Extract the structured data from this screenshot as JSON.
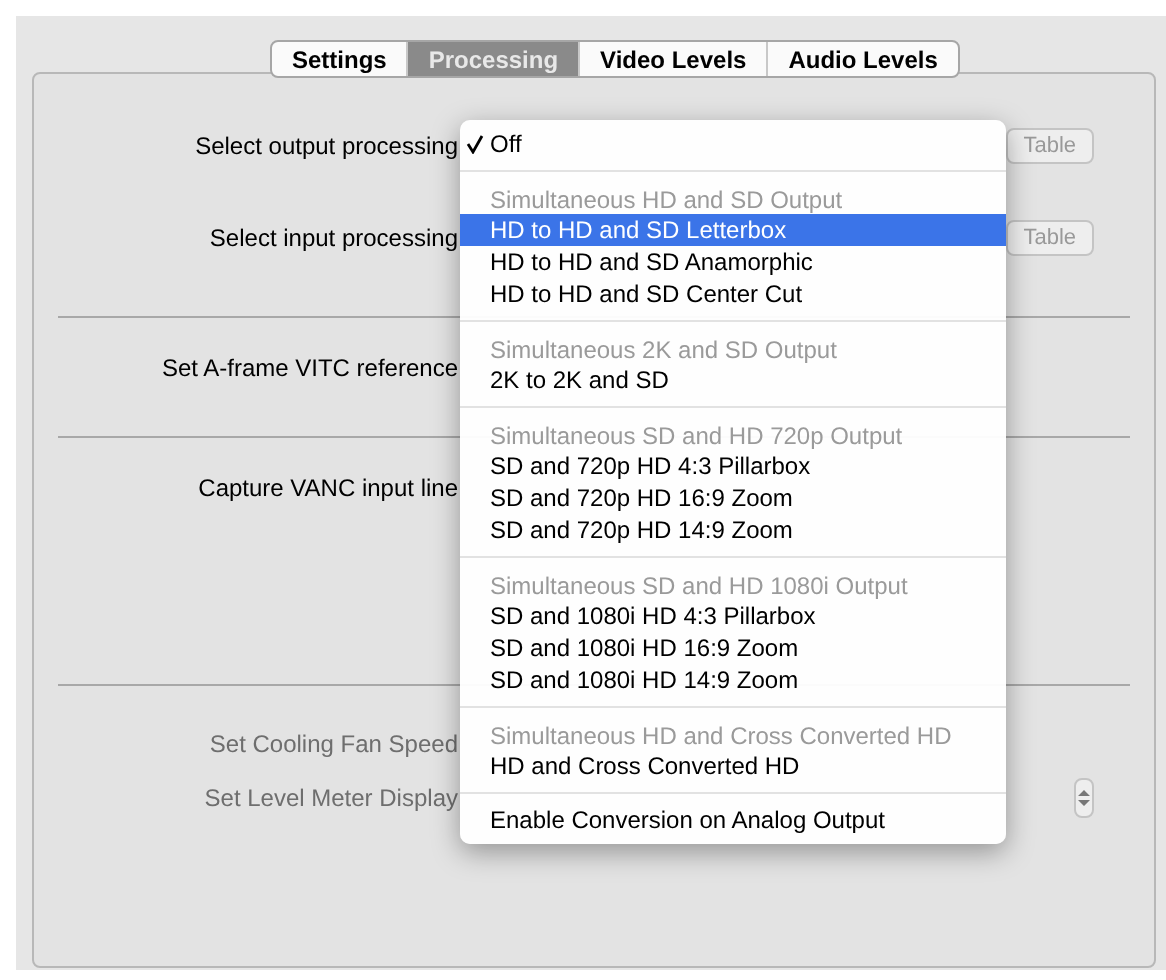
{
  "tabs": [
    {
      "label": "Settings",
      "selected": false
    },
    {
      "label": "Processing",
      "selected": true
    },
    {
      "label": "Video Levels",
      "selected": false
    },
    {
      "label": "Audio Levels",
      "selected": false
    }
  ],
  "sections": [
    {
      "rows": [
        {
          "label": "Select output processing",
          "button": "Table",
          "disabled": false
        },
        {
          "label": "Select input processing",
          "button": "Table",
          "disabled": false
        }
      ]
    },
    {
      "rows": [
        {
          "label": "Set A-frame VITC reference",
          "disabled": false
        }
      ]
    },
    {
      "rows": [
        {
          "label": "Capture VANC input line",
          "disabled": false
        }
      ]
    },
    {
      "rows": [
        {
          "label": "Set Cooling Fan Speed",
          "disabled": true
        },
        {
          "label": "Set Level Meter Display",
          "disabled": true,
          "stepper": true
        }
      ]
    }
  ],
  "menu": {
    "items": [
      {
        "kind": "item",
        "label": "Off",
        "checked": true,
        "selected": false
      },
      {
        "kind": "separator"
      },
      {
        "kind": "header",
        "label": "Simultaneous HD and SD Output"
      },
      {
        "kind": "item",
        "label": "HD to HD and SD Letterbox",
        "checked": false,
        "selected": true
      },
      {
        "kind": "item",
        "label": "HD to HD and SD Anamorphic",
        "checked": false,
        "selected": false
      },
      {
        "kind": "item",
        "label": "HD to HD and SD Center Cut",
        "checked": false,
        "selected": false
      },
      {
        "kind": "separator"
      },
      {
        "kind": "header",
        "label": "Simultaneous 2K and SD Output"
      },
      {
        "kind": "item",
        "label": "2K to 2K and SD",
        "checked": false,
        "selected": false
      },
      {
        "kind": "separator"
      },
      {
        "kind": "header",
        "label": "Simultaneous SD and HD 720p Output"
      },
      {
        "kind": "item",
        "label": "SD and 720p HD 4:3 Pillarbox",
        "checked": false,
        "selected": false
      },
      {
        "kind": "item",
        "label": "SD and 720p HD 16:9 Zoom",
        "checked": false,
        "selected": false
      },
      {
        "kind": "item",
        "label": "SD and 720p HD 14:9 Zoom",
        "checked": false,
        "selected": false
      },
      {
        "kind": "separator"
      },
      {
        "kind": "header",
        "label": "Simultaneous SD and HD 1080i Output"
      },
      {
        "kind": "item",
        "label": "SD and 1080i HD 4:3 Pillarbox",
        "checked": false,
        "selected": false
      },
      {
        "kind": "item",
        "label": "SD and 1080i HD 16:9 Zoom",
        "checked": false,
        "selected": false
      },
      {
        "kind": "item",
        "label": "SD and 1080i HD 14:9 Zoom",
        "checked": false,
        "selected": false
      },
      {
        "kind": "separator"
      },
      {
        "kind": "header",
        "label": "Simultaneous HD and Cross Converted HD"
      },
      {
        "kind": "item",
        "label": "HD and Cross Converted HD",
        "checked": false,
        "selected": false
      },
      {
        "kind": "separator"
      },
      {
        "kind": "item",
        "label": "Enable Conversion on Analog Output",
        "checked": false,
        "selected": false
      }
    ]
  }
}
